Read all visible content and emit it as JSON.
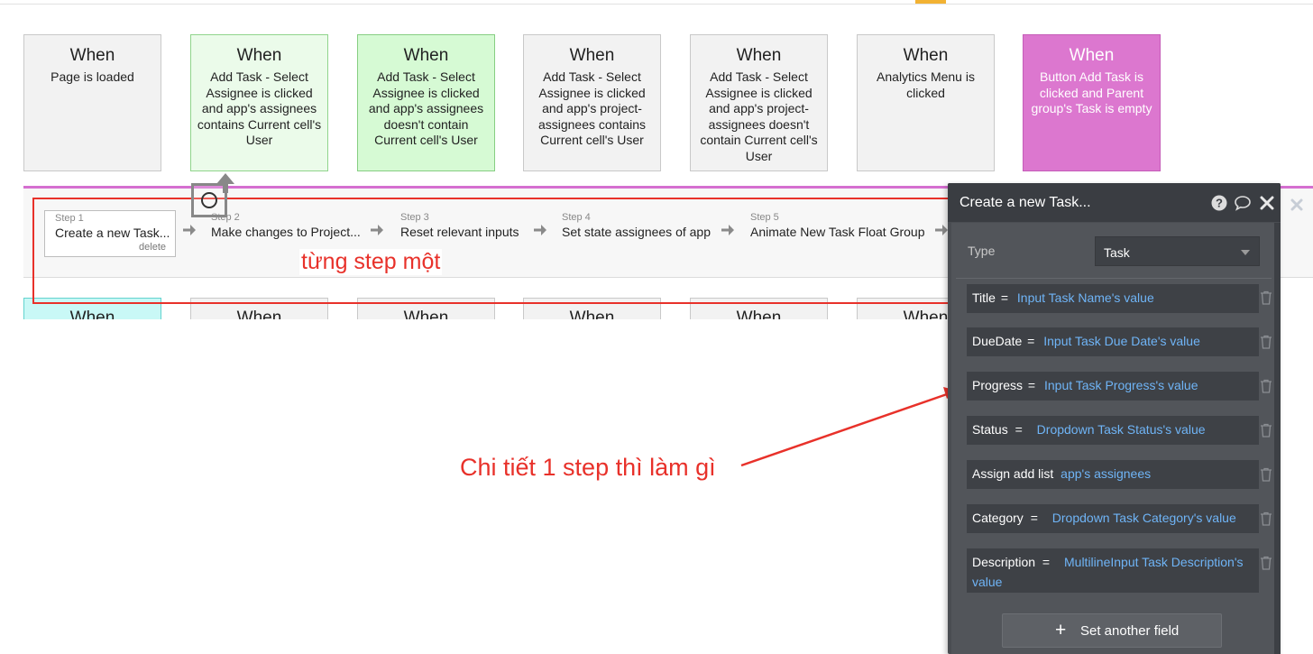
{
  "events": [
    {
      "when": "When",
      "desc": "Page is loaded",
      "color": "#f2f2f2"
    },
    {
      "when": "When",
      "desc": "Add Task - Select Assignee is clicked and app's assignees contains Current cell's User",
      "color": "#ebfbea"
    },
    {
      "when": "When",
      "desc": "Add Task - Select Assignee is clicked and app's assignees doesn't contain Current cell's User",
      "color": "#d6fad4"
    },
    {
      "when": "When",
      "desc": "Add Task - Select Assignee is clicked and app's project-assignees contains Current cell's User",
      "color": "#f2f2f2"
    },
    {
      "when": "When",
      "desc": "Add Task - Select Assignee is clicked and app's project-assignees doesn't contain Current cell's User",
      "color": "#f2f2f2"
    },
    {
      "when": "When",
      "desc": "Analytics Menu is clicked",
      "color": "#f2f2f2"
    },
    {
      "when": "When",
      "desc": "Button Add Task is clicked and Parent group's Task is empty",
      "color": "#dc77cf"
    }
  ],
  "steps": [
    {
      "label": "Step 1",
      "title": "Create a new Task...",
      "delete": "delete"
    },
    {
      "label": "Step 2",
      "title": "Make changes to Project..."
    },
    {
      "label": "Step 3",
      "title": "Reset relevant inputs"
    },
    {
      "label": "Step 4",
      "title": "Set state assignees of app"
    },
    {
      "label": "Step 5",
      "title": "Animate New Task Float Group"
    }
  ],
  "row2_when": [
    "When",
    "When",
    "When",
    "When",
    "When",
    "When"
  ],
  "annotations": {
    "steps_note": "từng step một",
    "detail_note": "Chi tiết 1 step thì làm gì"
  },
  "panel": {
    "title": "Create a new Task...",
    "type_label": "Type",
    "type_value": "Task",
    "fields": [
      {
        "key": "Title",
        "op": "=",
        "value": "Input Task Name's value"
      },
      {
        "key": "DueDate",
        "op": "=",
        "value": "Input Task Due Date's value"
      },
      {
        "key": "Progress",
        "op": "=",
        "value": "Input Task Progress's value"
      },
      {
        "key": "Status",
        "op": "=",
        "value": "Dropdown Task Status's value"
      },
      {
        "key": "Assign add list",
        "op": "",
        "value": "app's assignees"
      },
      {
        "key": "Category",
        "op": "=",
        "value": "Dropdown Task Category's value"
      },
      {
        "key": "Description",
        "op": "=",
        "value": "MultilineInput Task Description's value"
      }
    ],
    "set_another_field": "Set another field"
  },
  "colors": {
    "annotation_red": "#e8312a",
    "link_blue": "#6fb4f6",
    "pink_event": "#dc77cf"
  }
}
